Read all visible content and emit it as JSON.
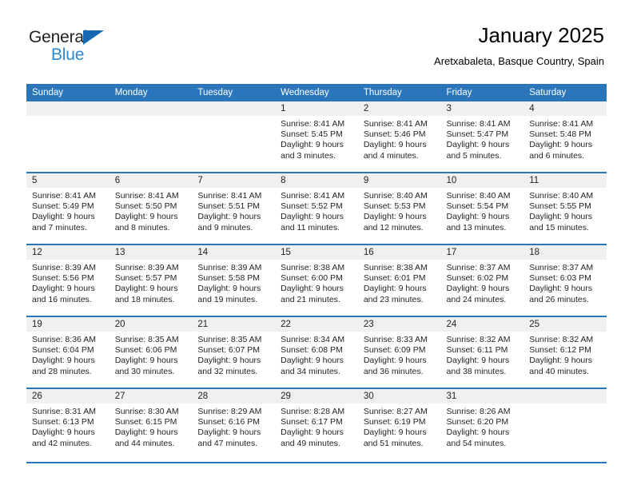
{
  "brand": {
    "name_part1": "General",
    "name_part2": "Blue",
    "color_dark": "#231f20",
    "color_blue": "#2a8ad4",
    "triangle_color": "#1668b3"
  },
  "header": {
    "month_title": "January 2025",
    "location": "Aretxabaleta, Basque Country, Spain"
  },
  "theme": {
    "header_bar": "#2b76bb",
    "day_band": "#f0f0f0",
    "row_divider": "#2b76bb",
    "text": "#231f20"
  },
  "weekday_headers": [
    "Sunday",
    "Monday",
    "Tuesday",
    "Wednesday",
    "Thursday",
    "Friday",
    "Saturday"
  ],
  "weeks": [
    [
      {
        "blank": true
      },
      {
        "blank": true
      },
      {
        "blank": true
      },
      {
        "day": "1",
        "sunrise": "Sunrise: 8:41 AM",
        "sunset": "Sunset: 5:45 PM",
        "daylight1": "Daylight: 9 hours",
        "daylight2": "and 3 minutes."
      },
      {
        "day": "2",
        "sunrise": "Sunrise: 8:41 AM",
        "sunset": "Sunset: 5:46 PM",
        "daylight1": "Daylight: 9 hours",
        "daylight2": "and 4 minutes."
      },
      {
        "day": "3",
        "sunrise": "Sunrise: 8:41 AM",
        "sunset": "Sunset: 5:47 PM",
        "daylight1": "Daylight: 9 hours",
        "daylight2": "and 5 minutes."
      },
      {
        "day": "4",
        "sunrise": "Sunrise: 8:41 AM",
        "sunset": "Sunset: 5:48 PM",
        "daylight1": "Daylight: 9 hours",
        "daylight2": "and 6 minutes."
      }
    ],
    [
      {
        "day": "5",
        "sunrise": "Sunrise: 8:41 AM",
        "sunset": "Sunset: 5:49 PM",
        "daylight1": "Daylight: 9 hours",
        "daylight2": "and 7 minutes."
      },
      {
        "day": "6",
        "sunrise": "Sunrise: 8:41 AM",
        "sunset": "Sunset: 5:50 PM",
        "daylight1": "Daylight: 9 hours",
        "daylight2": "and 8 minutes."
      },
      {
        "day": "7",
        "sunrise": "Sunrise: 8:41 AM",
        "sunset": "Sunset: 5:51 PM",
        "daylight1": "Daylight: 9 hours",
        "daylight2": "and 9 minutes."
      },
      {
        "day": "8",
        "sunrise": "Sunrise: 8:41 AM",
        "sunset": "Sunset: 5:52 PM",
        "daylight1": "Daylight: 9 hours",
        "daylight2": "and 11 minutes."
      },
      {
        "day": "9",
        "sunrise": "Sunrise: 8:40 AM",
        "sunset": "Sunset: 5:53 PM",
        "daylight1": "Daylight: 9 hours",
        "daylight2": "and 12 minutes."
      },
      {
        "day": "10",
        "sunrise": "Sunrise: 8:40 AM",
        "sunset": "Sunset: 5:54 PM",
        "daylight1": "Daylight: 9 hours",
        "daylight2": "and 13 minutes."
      },
      {
        "day": "11",
        "sunrise": "Sunrise: 8:40 AM",
        "sunset": "Sunset: 5:55 PM",
        "daylight1": "Daylight: 9 hours",
        "daylight2": "and 15 minutes."
      }
    ],
    [
      {
        "day": "12",
        "sunrise": "Sunrise: 8:39 AM",
        "sunset": "Sunset: 5:56 PM",
        "daylight1": "Daylight: 9 hours",
        "daylight2": "and 16 minutes."
      },
      {
        "day": "13",
        "sunrise": "Sunrise: 8:39 AM",
        "sunset": "Sunset: 5:57 PM",
        "daylight1": "Daylight: 9 hours",
        "daylight2": "and 18 minutes."
      },
      {
        "day": "14",
        "sunrise": "Sunrise: 8:39 AM",
        "sunset": "Sunset: 5:58 PM",
        "daylight1": "Daylight: 9 hours",
        "daylight2": "and 19 minutes."
      },
      {
        "day": "15",
        "sunrise": "Sunrise: 8:38 AM",
        "sunset": "Sunset: 6:00 PM",
        "daylight1": "Daylight: 9 hours",
        "daylight2": "and 21 minutes."
      },
      {
        "day": "16",
        "sunrise": "Sunrise: 8:38 AM",
        "sunset": "Sunset: 6:01 PM",
        "daylight1": "Daylight: 9 hours",
        "daylight2": "and 23 minutes."
      },
      {
        "day": "17",
        "sunrise": "Sunrise: 8:37 AM",
        "sunset": "Sunset: 6:02 PM",
        "daylight1": "Daylight: 9 hours",
        "daylight2": "and 24 minutes."
      },
      {
        "day": "18",
        "sunrise": "Sunrise: 8:37 AM",
        "sunset": "Sunset: 6:03 PM",
        "daylight1": "Daylight: 9 hours",
        "daylight2": "and 26 minutes."
      }
    ],
    [
      {
        "day": "19",
        "sunrise": "Sunrise: 8:36 AM",
        "sunset": "Sunset: 6:04 PM",
        "daylight1": "Daylight: 9 hours",
        "daylight2": "and 28 minutes."
      },
      {
        "day": "20",
        "sunrise": "Sunrise: 8:35 AM",
        "sunset": "Sunset: 6:06 PM",
        "daylight1": "Daylight: 9 hours",
        "daylight2": "and 30 minutes."
      },
      {
        "day": "21",
        "sunrise": "Sunrise: 8:35 AM",
        "sunset": "Sunset: 6:07 PM",
        "daylight1": "Daylight: 9 hours",
        "daylight2": "and 32 minutes."
      },
      {
        "day": "22",
        "sunrise": "Sunrise: 8:34 AM",
        "sunset": "Sunset: 6:08 PM",
        "daylight1": "Daylight: 9 hours",
        "daylight2": "and 34 minutes."
      },
      {
        "day": "23",
        "sunrise": "Sunrise: 8:33 AM",
        "sunset": "Sunset: 6:09 PM",
        "daylight1": "Daylight: 9 hours",
        "daylight2": "and 36 minutes."
      },
      {
        "day": "24",
        "sunrise": "Sunrise: 8:32 AM",
        "sunset": "Sunset: 6:11 PM",
        "daylight1": "Daylight: 9 hours",
        "daylight2": "and 38 minutes."
      },
      {
        "day": "25",
        "sunrise": "Sunrise: 8:32 AM",
        "sunset": "Sunset: 6:12 PM",
        "daylight1": "Daylight: 9 hours",
        "daylight2": "and 40 minutes."
      }
    ],
    [
      {
        "day": "26",
        "sunrise": "Sunrise: 8:31 AM",
        "sunset": "Sunset: 6:13 PM",
        "daylight1": "Daylight: 9 hours",
        "daylight2": "and 42 minutes."
      },
      {
        "day": "27",
        "sunrise": "Sunrise: 8:30 AM",
        "sunset": "Sunset: 6:15 PM",
        "daylight1": "Daylight: 9 hours",
        "daylight2": "and 44 minutes."
      },
      {
        "day": "28",
        "sunrise": "Sunrise: 8:29 AM",
        "sunset": "Sunset: 6:16 PM",
        "daylight1": "Daylight: 9 hours",
        "daylight2": "and 47 minutes."
      },
      {
        "day": "29",
        "sunrise": "Sunrise: 8:28 AM",
        "sunset": "Sunset: 6:17 PM",
        "daylight1": "Daylight: 9 hours",
        "daylight2": "and 49 minutes."
      },
      {
        "day": "30",
        "sunrise": "Sunrise: 8:27 AM",
        "sunset": "Sunset: 6:19 PM",
        "daylight1": "Daylight: 9 hours",
        "daylight2": "and 51 minutes."
      },
      {
        "day": "31",
        "sunrise": "Sunrise: 8:26 AM",
        "sunset": "Sunset: 6:20 PM",
        "daylight1": "Daylight: 9 hours",
        "daylight2": "and 54 minutes."
      },
      {
        "blank": true
      }
    ]
  ]
}
